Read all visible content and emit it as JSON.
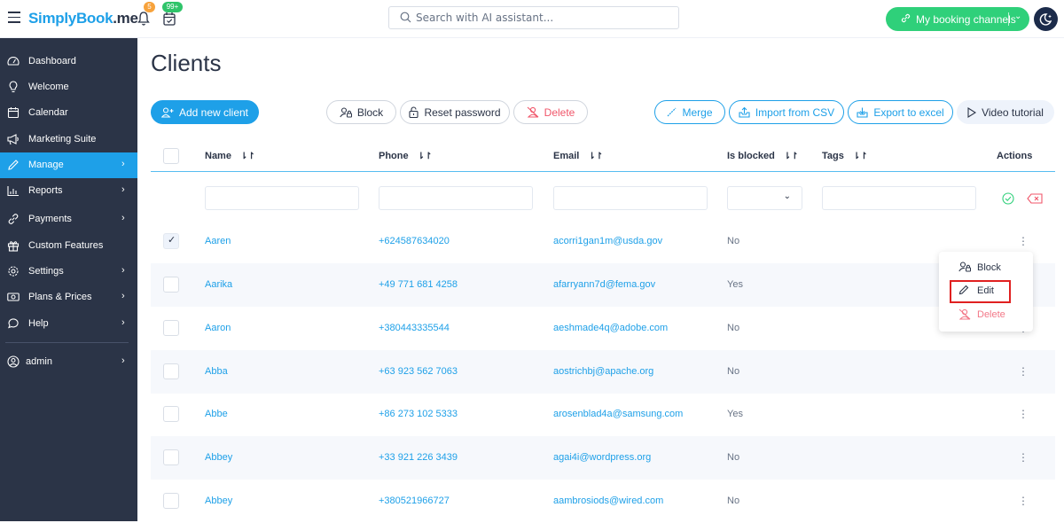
{
  "topbar": {
    "brand": "SimplyBook",
    "brand_suffix": ".me",
    "notifications_badge": "5",
    "calendar_badge": "99+",
    "search_placeholder": "Search with AI assistant...",
    "channels_label": "My booking channels",
    "brand_color": "#1ea0e8",
    "channels_color": "#2fd07a"
  },
  "sidebar": {
    "items": [
      {
        "label": "Dashboard",
        "icon": "dashboard-icon",
        "chevron": false,
        "active": false
      },
      {
        "label": "Welcome",
        "icon": "lightbulb-icon",
        "chevron": false,
        "active": false
      },
      {
        "label": "Calendar",
        "icon": "calendar-icon",
        "chevron": false,
        "active": false
      },
      {
        "label": "Marketing Suite",
        "icon": "megaphone-icon",
        "chevron": false,
        "active": false
      },
      {
        "label": "Manage",
        "icon": "pencil-icon",
        "chevron": true,
        "active": true
      },
      {
        "label": "Reports",
        "icon": "bar-chart-icon",
        "chevron": true,
        "active": false
      },
      {
        "label": "Payments",
        "icon": "link-icon",
        "chevron": true,
        "active": false
      },
      {
        "label": "Custom Features",
        "icon": "gift-icon",
        "chevron": false,
        "active": false
      },
      {
        "label": "Settings",
        "icon": "gear-icon",
        "chevron": true,
        "active": false
      },
      {
        "label": "Plans & Prices",
        "icon": "money-icon",
        "chevron": true,
        "active": false
      },
      {
        "label": "Help",
        "icon": "chat-bubble-icon",
        "chevron": true,
        "active": false
      }
    ],
    "user": {
      "label": "admin",
      "icon": "user-circle-icon"
    }
  },
  "page": {
    "title": "Clients"
  },
  "toolbar": {
    "add_client": "Add new client",
    "block": "Block",
    "reset_password": "Reset password",
    "delete": "Delete",
    "merge": "Merge",
    "import_csv": "Import from CSV",
    "export_excel": "Export to excel",
    "video_tutorial": "Video tutorial"
  },
  "table": {
    "columns": {
      "name": "Name",
      "phone": "Phone",
      "email": "Email",
      "is_blocked": "Is blocked",
      "tags": "Tags",
      "actions": "Actions"
    },
    "filters": {
      "name": "",
      "phone": "",
      "email": "",
      "is_blocked": "",
      "tags": ""
    },
    "rows": [
      {
        "name": "Aaren",
        "phone": "+624587634020",
        "email": "acorri1gan1m@usda.gov",
        "blocked": "No",
        "checked": true
      },
      {
        "name": "Aarika",
        "phone": "+49 771 681 4258",
        "email": "afarryann7d@fema.gov",
        "blocked": "Yes",
        "checked": false
      },
      {
        "name": "Aaron",
        "phone": "+380443335544",
        "email": "aeshmade4q@adobe.com",
        "blocked": "No",
        "checked": false
      },
      {
        "name": "Abba",
        "phone": "+63 923 562 7063",
        "email": "aostrichbj@apache.org",
        "blocked": "No",
        "checked": false
      },
      {
        "name": "Abbe",
        "phone": "+86 273 102 5333",
        "email": "arosenblad4a@samsung.com",
        "blocked": "Yes",
        "checked": false
      },
      {
        "name": "Abbey",
        "phone": "+33 921 226 3439",
        "email": "agai4i@wordpress.org",
        "blocked": "No",
        "checked": false
      },
      {
        "name": "Abbey",
        "phone": "+380521966727",
        "email": "aambrosiods@wired.com",
        "blocked": "No",
        "checked": false
      }
    ]
  },
  "row_menu": {
    "items": [
      {
        "label": "Block",
        "icon": "user-lock-icon"
      },
      {
        "label": "Edit",
        "icon": "pencil-icon",
        "highlighted": true
      },
      {
        "label": "Delete",
        "icon": "user-remove-icon"
      }
    ]
  }
}
